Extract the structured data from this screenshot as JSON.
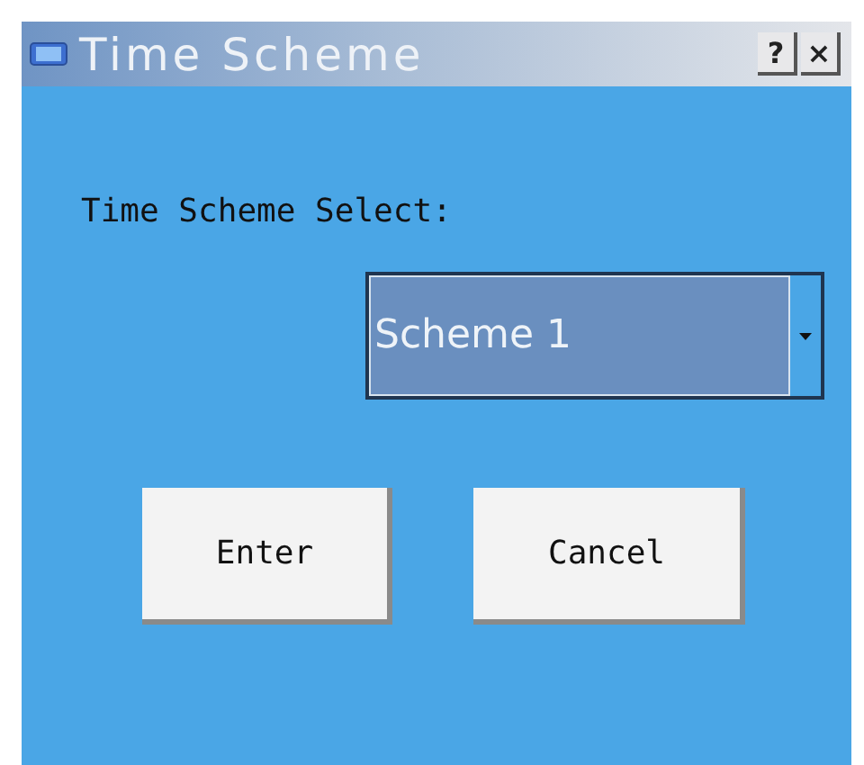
{
  "window": {
    "title": "Time Scheme"
  },
  "title_buttons": [
    "?",
    "×"
  ],
  "prompt": "Time Scheme Select:",
  "dropdown": {
    "value": "Scheme 1"
  },
  "buttons": [
    "Enter",
    "Cancel"
  ]
}
